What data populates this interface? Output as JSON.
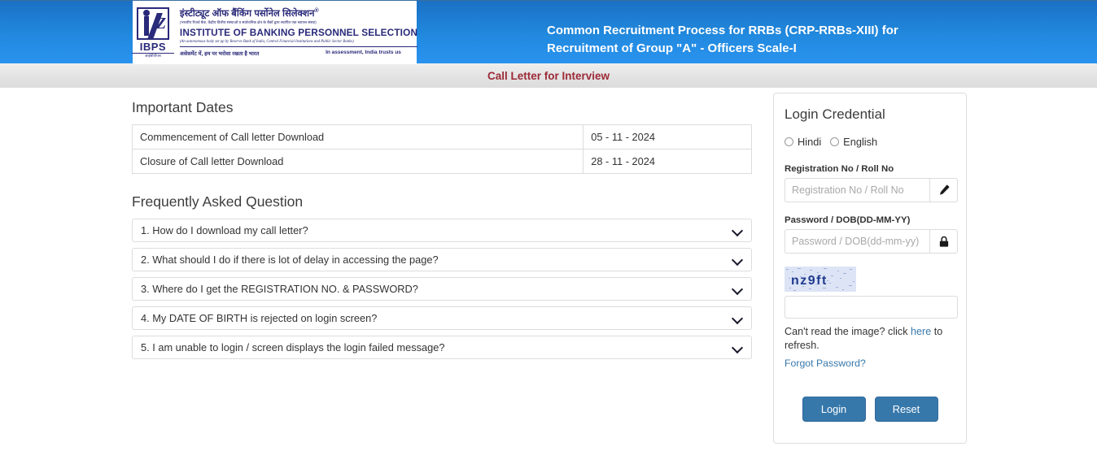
{
  "header": {
    "logo": {
      "hindi_title": "इंस्टीट्यूट ऑफ बैंकिंग पर्सोनेल सिलेक्शन",
      "hindi_sub": "(भारतीय रिजर्व बैंक, केंद्रीय वित्तीय संस्थाओं व सार्वजनिक क्षेत्र के बैंकों द्वारा स्थापित एक स्वायत्त संस्था)",
      "english_title": "INSTITUTE OF BANKING PERSONNEL SELECTION",
      "english_sub": "(An autonomous body set up by Reserve Bank of India, Central Financial Institutions and Public Sector Banks)",
      "tagline_hindi": "असेसमेंट में, हम पर भरोसा रखता है भारत",
      "tagline_english": "In assessment, India trusts us",
      "acronym": "IBPS",
      "acronym_sub": "आईबीपीएस"
    },
    "title_line1": "Common Recruitment Process for RRBs (CRP-RRBs-XIII) for",
    "title_line2": "Recruitment of Group \"A\" - Officers Scale-I",
    "subtitle": "Call Letter for Interview",
    "gradient_top": "#1b71c4",
    "gradient_bottom": "#2a93ef",
    "subtitle_color": "#9c2a37"
  },
  "important_dates": {
    "heading": "Important Dates",
    "rows": [
      {
        "label": "Commencement of Call letter Download",
        "value": "05 - 11 - 2024"
      },
      {
        "label": "Closure of Call letter Download",
        "value": "28 - 11 - 2024"
      }
    ]
  },
  "faq": {
    "heading": "Frequently Asked Question",
    "items": [
      {
        "question": "1. How do I download my call letter?"
      },
      {
        "question": "2. What should I do if there is lot of delay in accessing the page?"
      },
      {
        "question": "3. Where do I get the REGISTRATION NO. & PASSWORD?"
      },
      {
        "question": "4. My DATE OF BIRTH is rejected on login screen?"
      },
      {
        "question": "5. I am unable to login / screen displays the login failed message?"
      }
    ]
  },
  "login": {
    "heading": "Login Credential",
    "language_options": [
      {
        "label": "Hindi",
        "selected": false
      },
      {
        "label": "English",
        "selected": false
      }
    ],
    "registration": {
      "label": "Registration No / Roll No",
      "placeholder": "Registration No / Roll No",
      "value": "",
      "icon": "pencil-icon"
    },
    "password": {
      "label": "Password / DOB(DD-MM-YY)",
      "placeholder": "Password / DOB(dd-mm-yy)",
      "value": "",
      "icon": "lock-icon"
    },
    "captcha": {
      "text": "nz9ft",
      "value": "",
      "placeholder": "",
      "text_color": "#1f3a8f",
      "background_color": "#dce4f5"
    },
    "refresh_prefix": "Can't read the image? click ",
    "refresh_link": "here",
    "refresh_suffix": " to refresh.",
    "forgot_password": "Forgot Password?",
    "login_button": "Login",
    "reset_button": "Reset",
    "button_color": "#3778ab",
    "link_color": "#3778ab"
  }
}
